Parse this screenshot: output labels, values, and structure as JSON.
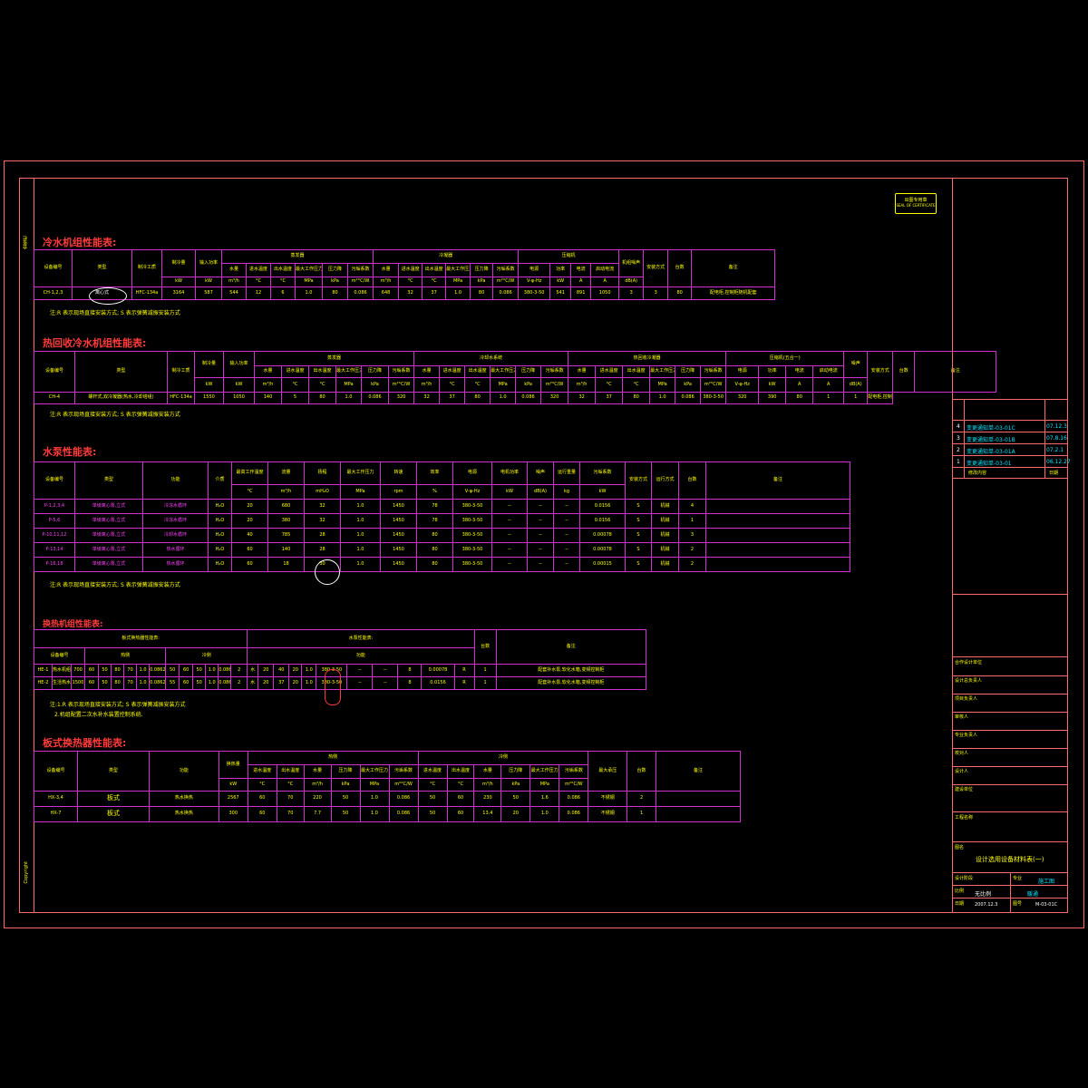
{
  "stamp": {
    "line1": "出图专用章",
    "line2": "SEAL OF CERTIFICATE"
  },
  "left_margin": {
    "top_text": "会签栏",
    "bottom_text": "Copyright"
  },
  "chiller": {
    "title": "冷水机组性能表:",
    "header1": [
      "设备编号",
      "类型",
      "制冷工质",
      "制冷量",
      "输入功率",
      "蒸发器",
      "冷凝器",
      "压缩机",
      "机组噪声",
      "安装方式",
      "台数",
      "备注"
    ],
    "header2": [
      "水量",
      "进水温度",
      "出水温度",
      "最大工作压力",
      "压力降",
      "污垢系数",
      "水量",
      "进水温度",
      "出水温度",
      "最大工作压力",
      "压力降",
      "污垢系数",
      "电源",
      "功率",
      "电流",
      "启动电流"
    ],
    "units": [
      "kW",
      "kW",
      "m³/h",
      "°C",
      "°C",
      "MPa",
      "kPa",
      "m²°C/W",
      "m³/h",
      "°C",
      "°C",
      "MPa",
      "kPa",
      "m²°C/W",
      "V-φ-Hz",
      "kW",
      "A",
      "A",
      "dB(A)"
    ],
    "rows": [
      [
        "CH-1,2,3",
        "离心式",
        "HFC-134a",
        "3164",
        "587",
        "544",
        "12",
        "6",
        "1.0",
        "80",
        "0.086",
        "648",
        "32",
        "37",
        "1.0",
        "80",
        "0.086",
        "380-3-50",
        "541",
        "891",
        "1050",
        "80",
        "3",
        "3",
        "配电柜,控制柜随机配套"
      ]
    ],
    "note": "注:R 表示现场直接安装方式; S 表示弹簧减振安装方式"
  },
  "heat_recovery": {
    "title": "热回收冷水机组性能表:",
    "header1": [
      "设备编号",
      "类型",
      "制冷工质",
      "制冷量",
      "输入功率",
      "蒸发器",
      "冷却水系统",
      "热回收冷凝器",
      "压缩机(五合一)",
      "噪声",
      "安装方式",
      "台数",
      "备注"
    ],
    "rows": [
      [
        "CH-4",
        "螺杆式,双冷凝器(热水,冷却塔组)",
        "HFC-134a",
        "1550",
        "1050",
        "140",
        "5",
        "80",
        "1.0",
        "0.086",
        "320",
        "32",
        "37",
        "80",
        "1.0",
        "0.086",
        "380-3-50",
        "320",
        "390",
        "80",
        "1",
        "1",
        "配电柜,控制柜随机配套"
      ]
    ],
    "note": "注:R 表示现场直接安装方式; S 表示弹簧减振安装方式"
  },
  "pumps": {
    "title": "水泵性能表:",
    "header": [
      "设备编号",
      "类型",
      "功能",
      "介质",
      "最高工作温度",
      "流量",
      "扬程",
      "最大工作压力",
      "转速",
      "效率",
      "电源",
      "电机功率",
      "噪声",
      "运行重量",
      "污垢系数",
      "安装方式",
      "运行方式",
      "台数",
      "备注"
    ],
    "units": [
      "°C",
      "m³/h",
      "mH₂O",
      "MPa",
      "rpm",
      "%",
      "V-φ-Hz",
      "kW",
      "dB(A)",
      "kg",
      "kW"
    ],
    "rows": [
      [
        "P-1,2,3,4",
        "单级离心泵,立式",
        "冷冻水循环",
        "H₂O",
        "20",
        "680",
        "32",
        "1.0",
        "1450",
        "78",
        "380-3-50",
        "--",
        "--",
        "--",
        "0.0156",
        "S",
        "机械",
        "4",
        ""
      ],
      [
        "P-5,6",
        "单级离心泵,立式",
        "冷冻水循环",
        "H₂O",
        "20",
        "380",
        "32",
        "1.0",
        "1450",
        "78",
        "380-3-50",
        "--",
        "--",
        "--",
        "0.0156",
        "S",
        "机械",
        "1",
        ""
      ],
      [
        "P-10,11,12",
        "单级离心泵,立式",
        "冷却水循环",
        "H₂O",
        "40",
        "785",
        "28",
        "1.0",
        "1450",
        "80",
        "380-3-50",
        "--",
        "--",
        "--",
        "0.00078",
        "S",
        "机械",
        "3",
        ""
      ],
      [
        "P-13,14",
        "单级离心泵,立式",
        "热水循环",
        "H₂O",
        "60",
        "140",
        "28",
        "1.0",
        "1450",
        "80",
        "380-3-50",
        "--",
        "--",
        "--",
        "0.00078",
        "S",
        "机械",
        "2",
        ""
      ],
      [
        "P-16,18",
        "单级离心泵,立式",
        "热水循环",
        "H₂O",
        "60",
        "18",
        "30",
        "1.0",
        "1450",
        "80",
        "380-3-50",
        "--",
        "--",
        "--",
        "0.00015",
        "S",
        "机械",
        "2",
        ""
      ]
    ],
    "note": "注:R 表示现场直接安装方式; S 表示弹簧减振安装方式"
  },
  "exchanger_unit": {
    "title": "换热机组性能表:",
    "rows": [
      [
        "HE-1",
        "热水机组",
        "700",
        "60",
        "50",
        "80",
        "70",
        "1.0",
        "0.0862",
        "50",
        "60",
        "50",
        "1.0",
        "0.0862",
        "2",
        "水",
        "20",
        "40",
        "20",
        "1.0",
        "380-3-50",
        "--",
        "--",
        "8",
        "0.00078",
        "R",
        "1",
        "配套补水泵,软化水箱,变频控制柜"
      ],
      [
        "HE-2",
        "生活热水机组",
        "1500",
        "60",
        "50",
        "80",
        "70",
        "1.0",
        "0.0862",
        "55",
        "60",
        "50",
        "1.0",
        "0.0862",
        "2",
        "水",
        "20",
        "37",
        "20",
        "1.0",
        "380-3-50",
        "--",
        "--",
        "8",
        "0.0156",
        "R",
        "1",
        "配套补水泵,软化水箱,变频控制柜"
      ]
    ],
    "note1": "注:1.R 表示现场直接安装方式; S 表示弹簧减振安装方式",
    "note2": "2.机组配置二次水补水装置控制系统."
  },
  "plate_exchanger": {
    "title": "板式换热器性能表:",
    "header1": [
      "设备编号",
      "类型",
      "功能",
      "换热量",
      "热侧",
      "冷侧",
      "最大承压",
      "台数",
      "备注"
    ],
    "units": [
      "kW",
      "°C",
      "°C",
      "m³/h",
      "kPa",
      "MPa",
      "m²°C/W",
      "°C",
      "°C",
      "m³/h",
      "kPa",
      "MPa",
      "m²°C/W"
    ],
    "rows": [
      [
        "HX-3,4",
        "板式",
        "热水换热",
        "2567",
        "60",
        "70",
        "220",
        "50",
        "1.0",
        "0.086",
        "50",
        "60",
        "230",
        "50",
        "1.6",
        "0.086",
        "不锈钢",
        "2",
        ""
      ],
      [
        "HX-7",
        "板式",
        "热水换热",
        "300",
        "60",
        "70",
        "7.7",
        "50",
        "1.0",
        "0.086",
        "50",
        "60",
        "13.4",
        "20",
        "1.0",
        "0.086",
        "不锈钢",
        "1",
        ""
      ]
    ]
  },
  "title_block": {
    "revisions": [
      {
        "no": "4",
        "text": "变更通知单-03-01C",
        "date": "07.12.3"
      },
      {
        "no": "3",
        "text": "变更通知单-03-01B",
        "date": "07.8.16"
      },
      {
        "no": "2",
        "text": "变更通知单-03-01A",
        "date": "07.2.1"
      },
      {
        "no": "1",
        "text": "变更通知单-03-01",
        "date": "06.12.27"
      }
    ],
    "rev_header": {
      "c1": "修改内容",
      "c2": "日期"
    },
    "labels": [
      "合作设计单位",
      "设计总负责人",
      "项目负责人",
      "审核人",
      "专业负责人",
      "校对人",
      "设计人",
      "建设单位",
      "工程名称",
      "图名"
    ],
    "drawing_name": "设计选用设备材料表(一)",
    "stage_label": "设计阶段",
    "stage_value": "施工图",
    "discipline_label": "专业",
    "discipline_value": "暖通",
    "scale_label": "比例",
    "scale_value": "无比例",
    "date_label": "日期",
    "date_value": "2007.12.3",
    "number_label": "图号",
    "number_value": "M-03-01C"
  }
}
